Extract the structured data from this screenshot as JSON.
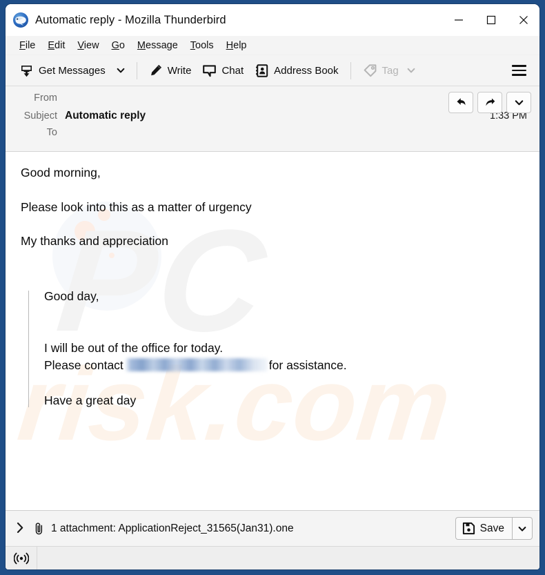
{
  "window": {
    "title": "Automatic reply - Mozilla Thunderbird",
    "app_icon": "thunderbird-logo",
    "minimize_label": "Minimize",
    "maximize_label": "Maximize",
    "close_label": "Close",
    "accent_border_color": "#1f4e87"
  },
  "menubar": {
    "items": [
      {
        "label": "File",
        "accesskey": "F"
      },
      {
        "label": "Edit",
        "accesskey": "E"
      },
      {
        "label": "View",
        "accesskey": "V"
      },
      {
        "label": "Go",
        "accesskey": "G"
      },
      {
        "label": "Message",
        "accesskey": "M"
      },
      {
        "label": "Tools",
        "accesskey": "T"
      },
      {
        "label": "Help",
        "accesskey": "H"
      }
    ]
  },
  "toolbar": {
    "get_messages_label": "Get Messages",
    "get_messages_icon": "inbox-download-icon",
    "get_messages_caret_icon": "chevron-down-icon",
    "write_label": "Write",
    "write_icon": "pencil-icon",
    "chat_label": "Chat",
    "chat_icon": "speech-bubble-icon",
    "address_book_label": "Address Book",
    "address_book_icon": "address-book-icon",
    "tag_label": "Tag",
    "tag_icon": "tag-icon",
    "tag_caret_icon": "chevron-down-icon",
    "tag_disabled": true,
    "app_menu_icon": "hamburger-menu-icon"
  },
  "message_header": {
    "from_label": "From",
    "from_value": "",
    "subject_label": "Subject",
    "subject_value": "Automatic reply",
    "to_label": "To",
    "to_value": "",
    "time": "1:33 PM",
    "actions": [
      {
        "name": "reply",
        "icon": "reply-arrow-icon"
      },
      {
        "name": "forward",
        "icon": "forward-arrow-icon"
      },
      {
        "name": "more",
        "icon": "chevron-down-icon"
      }
    ]
  },
  "body": {
    "paragraphs": [
      "Good morning,",
      "Please look into this as a matter of urgency",
      "My thanks and appreciation"
    ],
    "quote": {
      "greeting": "Good day,",
      "line1": "I will be out of the office for today.",
      "line2_prefix": "Please contact",
      "line2_redacted": "",
      "line2_suffix": "for assistance.",
      "closing": "Have a great day"
    },
    "watermark": {
      "primary": "PC",
      "secondary": "risk.com"
    }
  },
  "attachment_bar": {
    "expand_icon": "chevron-right-icon",
    "clip_icon": "paperclip-icon",
    "text": "1 attachment: ApplicationReject_31565(Jan31).one",
    "count": "1",
    "filename": "ApplicationReject_31565(Jan31).one",
    "save_label": "Save",
    "save_icon": "floppy-disk-icon",
    "save_caret_icon": "chevron-down-icon"
  },
  "statusbar": {
    "online_icon": "broadcast-online-icon"
  }
}
